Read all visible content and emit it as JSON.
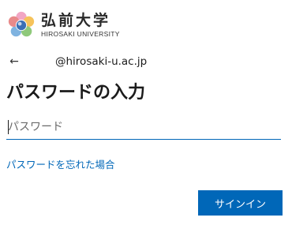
{
  "branding": {
    "name_jp": "弘前大学",
    "name_en": "HIROSAKI UNIVERSITY",
    "logo_icon": "university-blossom-logo"
  },
  "identity": {
    "back_icon": "back-arrow-icon",
    "back_glyph": "←",
    "email": "@hirosaki-u.ac.jp"
  },
  "form": {
    "title": "パスワードの入力",
    "password_placeholder": "パスワード",
    "password_value": "",
    "forgot_link": "パスワードを忘れた場合",
    "signin_button": "サインイン"
  },
  "colors": {
    "accent": "#0067b8",
    "text": "#1b1b1b",
    "background": "#ffffff"
  }
}
